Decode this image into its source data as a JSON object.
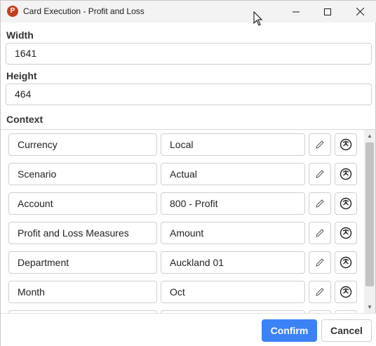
{
  "window": {
    "title": "Card Execution - Profit and Loss",
    "app_icon_letter": "P"
  },
  "fields": {
    "width": {
      "label": "Width",
      "value": "1641"
    },
    "height": {
      "label": "Height",
      "value": "464"
    }
  },
  "context": {
    "label": "Context",
    "rows": [
      {
        "key": "Currency",
        "value": "Local"
      },
      {
        "key": "Scenario",
        "value": "Actual"
      },
      {
        "key": "Account",
        "value": "800 - Profit"
      },
      {
        "key": "Profit and Loss Measures",
        "value": "Amount"
      },
      {
        "key": "Department",
        "value": "Auckland 01"
      },
      {
        "key": "Month",
        "value": "Oct"
      },
      {
        "key": "",
        "value": ""
      }
    ]
  },
  "footer": {
    "confirm_label": "Confirm",
    "cancel_label": "Cancel"
  },
  "colors": {
    "accent": "#3b82f6",
    "app_icon": "#c43e1c"
  }
}
